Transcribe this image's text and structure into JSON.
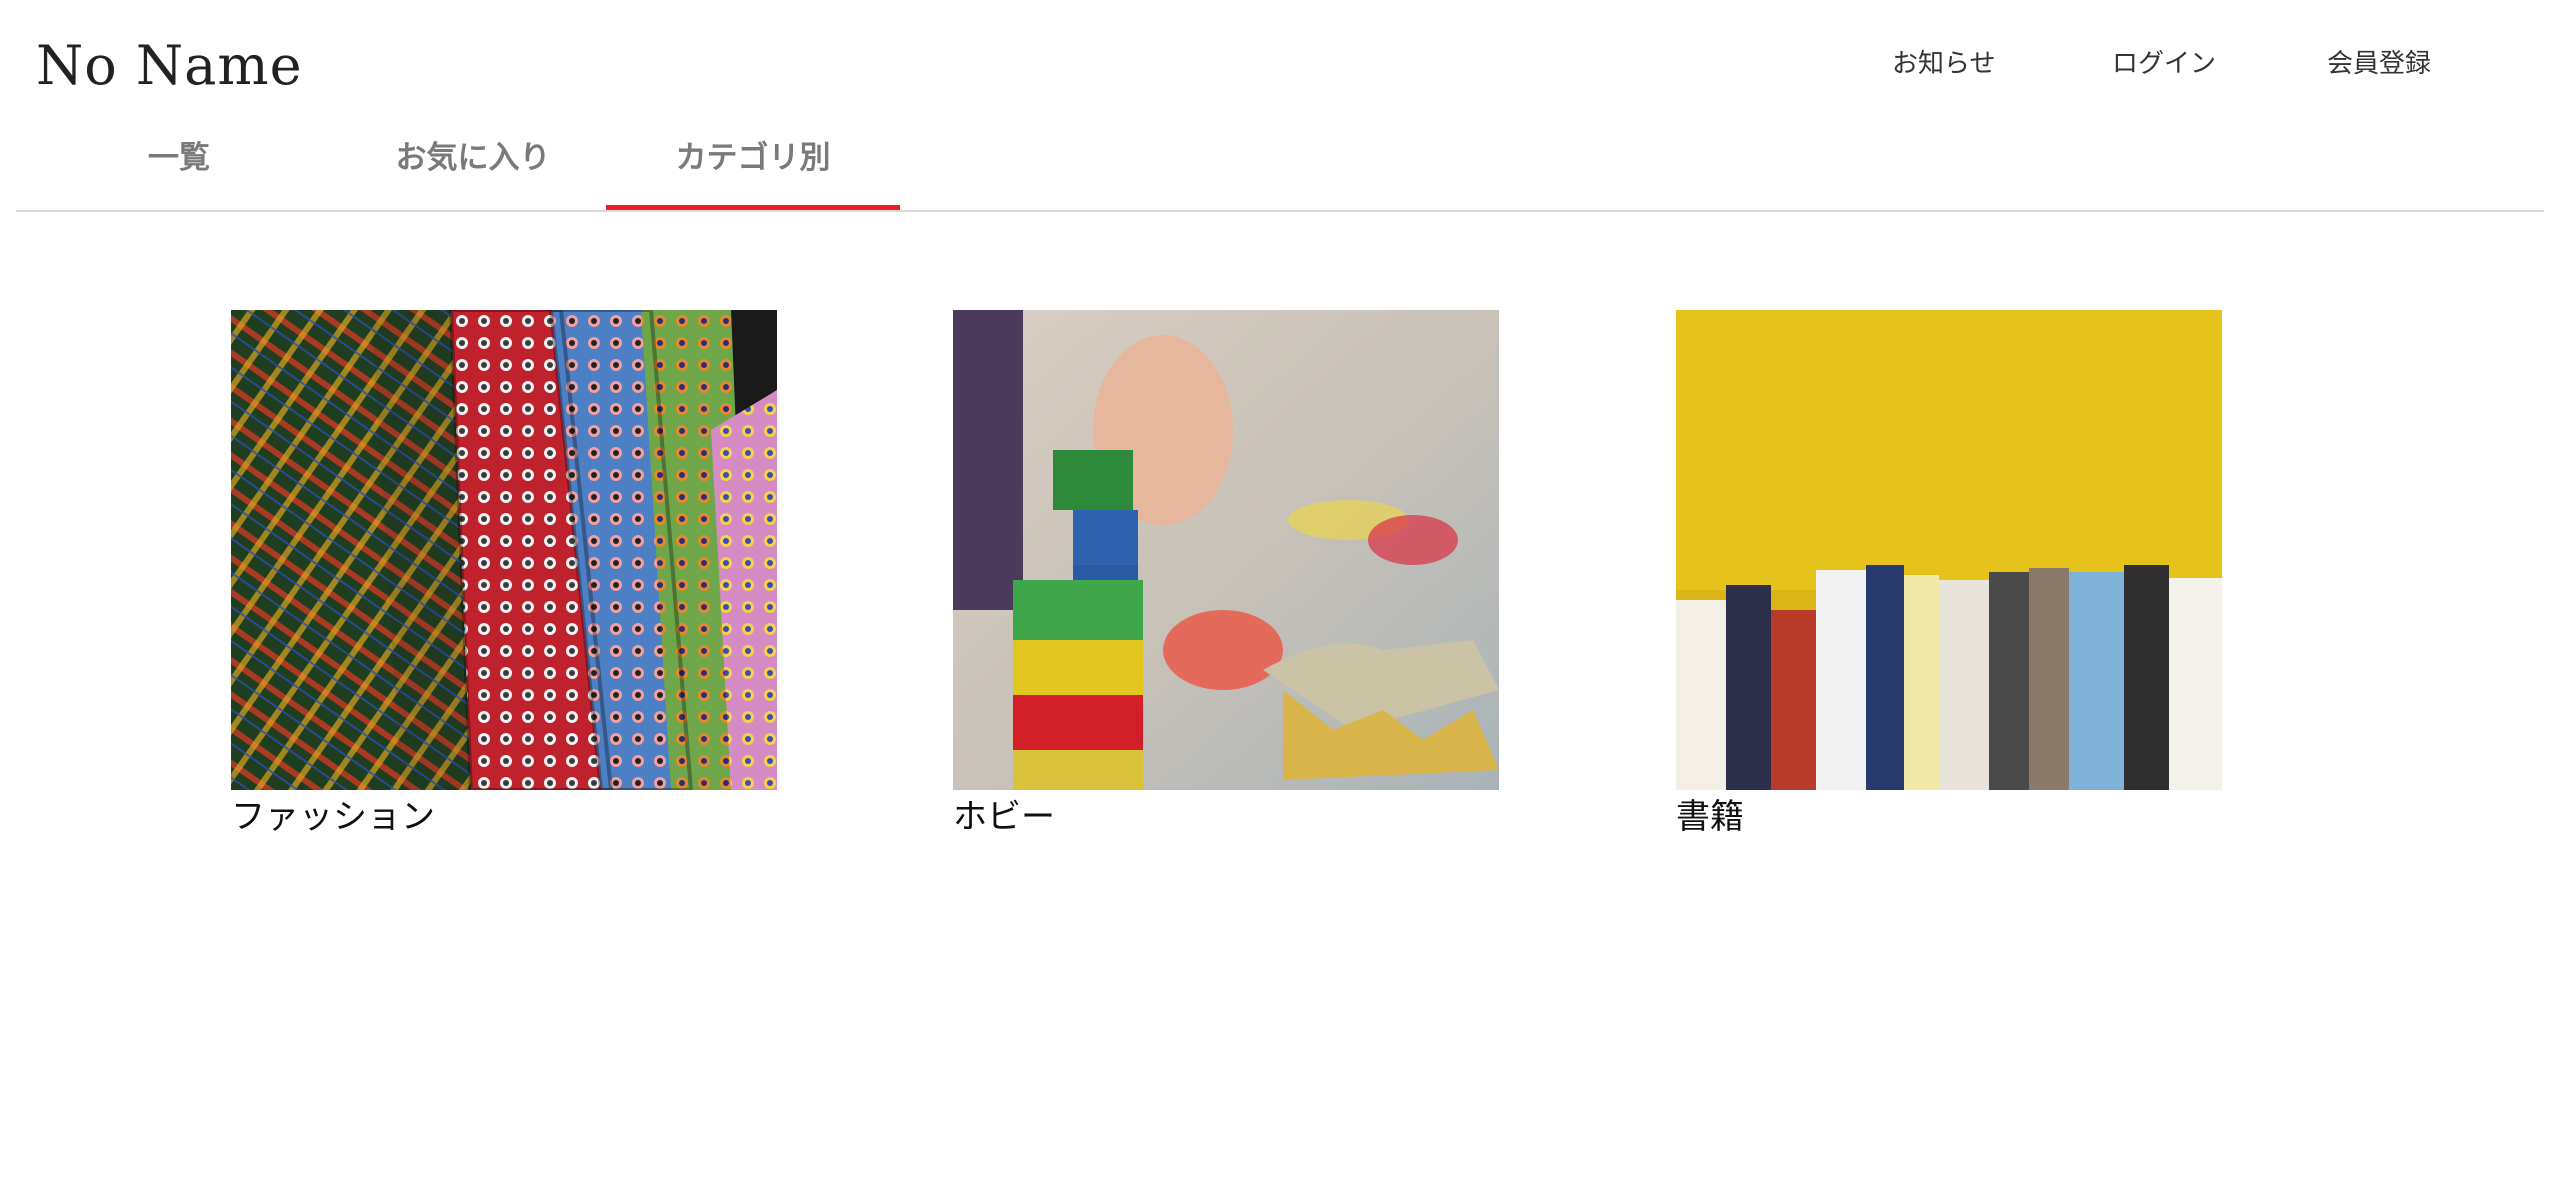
{
  "header": {
    "logo": "No Name",
    "nav": [
      {
        "label": "お知らせ"
      },
      {
        "label": "ログイン"
      },
      {
        "label": "会員登録"
      }
    ]
  },
  "tabs": [
    {
      "label": "一覧",
      "active": false
    },
    {
      "label": "お気に入り",
      "active": false
    },
    {
      "label": "カテゴリ別",
      "active": true
    }
  ],
  "accent_color": "#ee1c25",
  "categories": [
    {
      "label": "ファッション",
      "image": "neckties-photo"
    },
    {
      "label": "ホビー",
      "image": "toy-blocks-photo"
    },
    {
      "label": "書籍",
      "image": "books-photo"
    }
  ]
}
